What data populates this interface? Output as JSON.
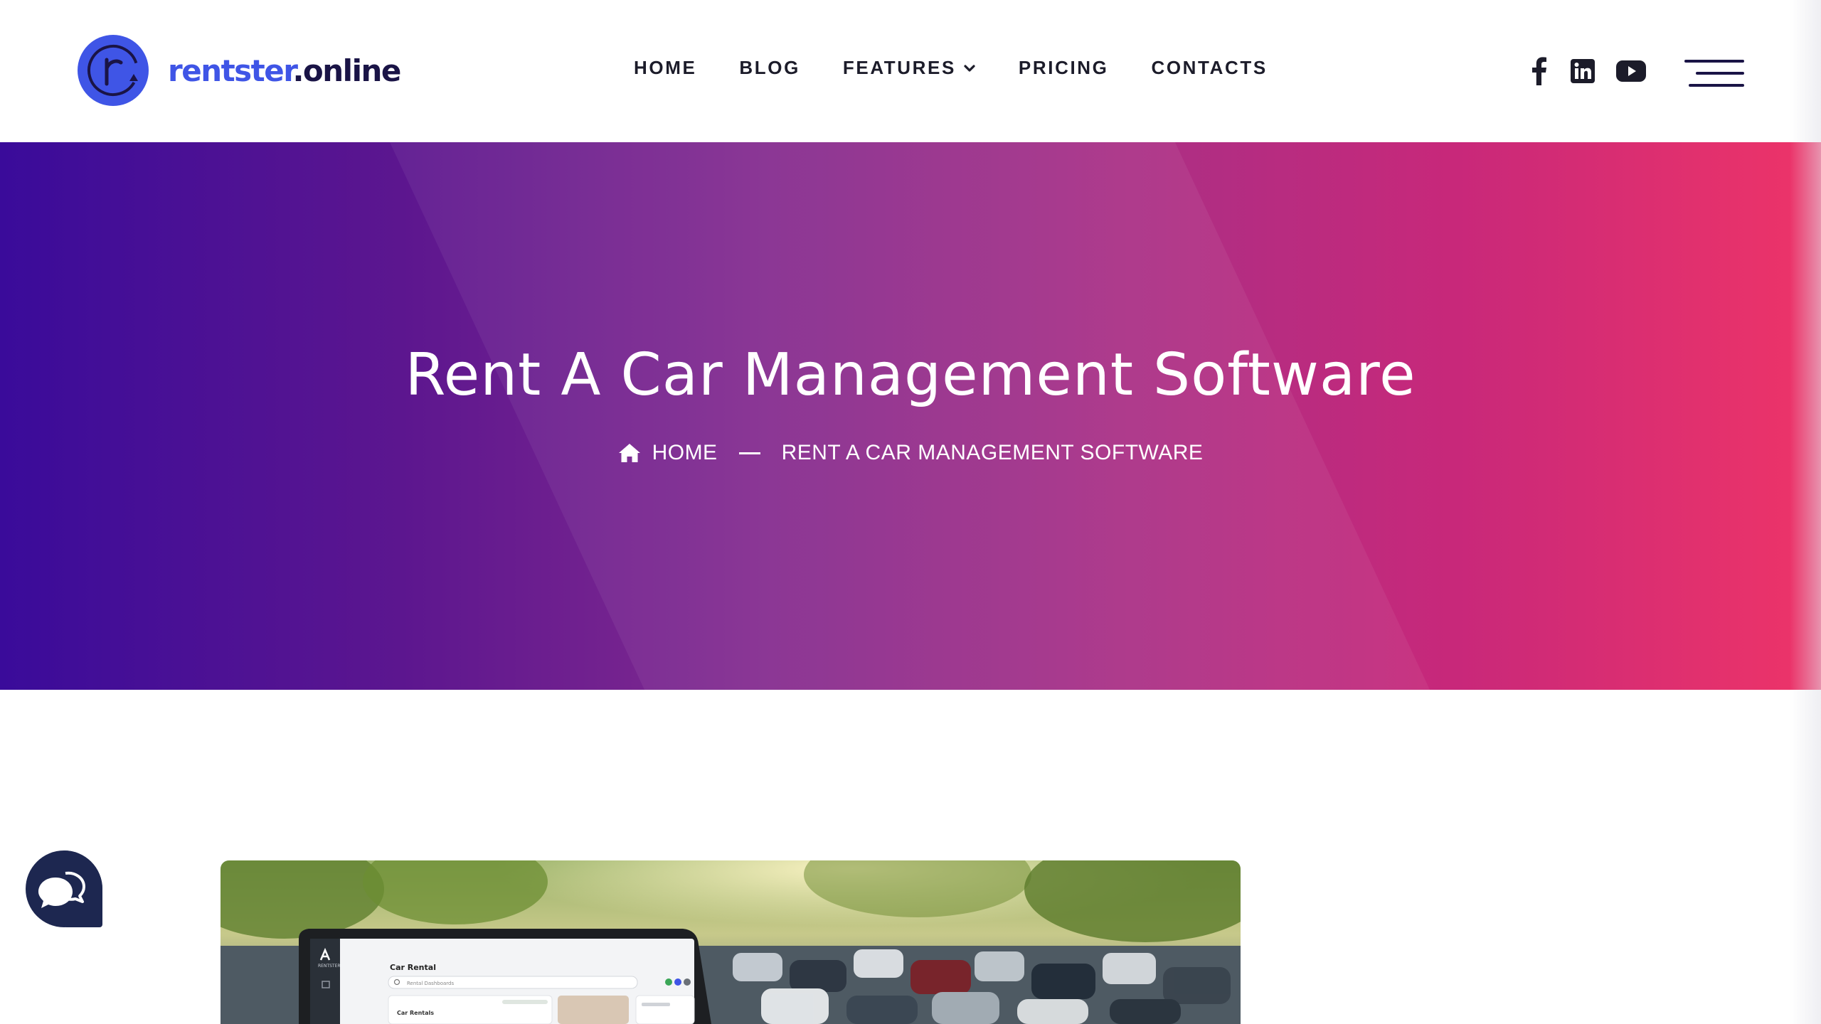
{
  "brand": {
    "name_part1": "rentster",
    "name_part2": ".online",
    "accent": "#3f55e6",
    "dark": "#1a1446"
  },
  "nav": {
    "home": "HOME",
    "blog": "BLOG",
    "features": "FEATURES",
    "pricing": "PRICING",
    "contacts": "CONTACTS"
  },
  "socials": [
    "facebook-icon",
    "linkedin-icon",
    "youtube-icon"
  ],
  "hero": {
    "title": "Rent A Car Management Software",
    "breadcrumb": {
      "home": "HOME",
      "current": "RENT A CAR MANAGEMENT SOFTWARE"
    },
    "gradient_start": "#3a0b9a",
    "gradient_end": "#ee3468"
  },
  "feature_image": {
    "screen_title": "Car Rental",
    "search_placeholder": "Rental Dashboards",
    "row_label": "Car Rentals",
    "sidebar_brand": "RENTSTER"
  },
  "chat_color": "#1d2750"
}
